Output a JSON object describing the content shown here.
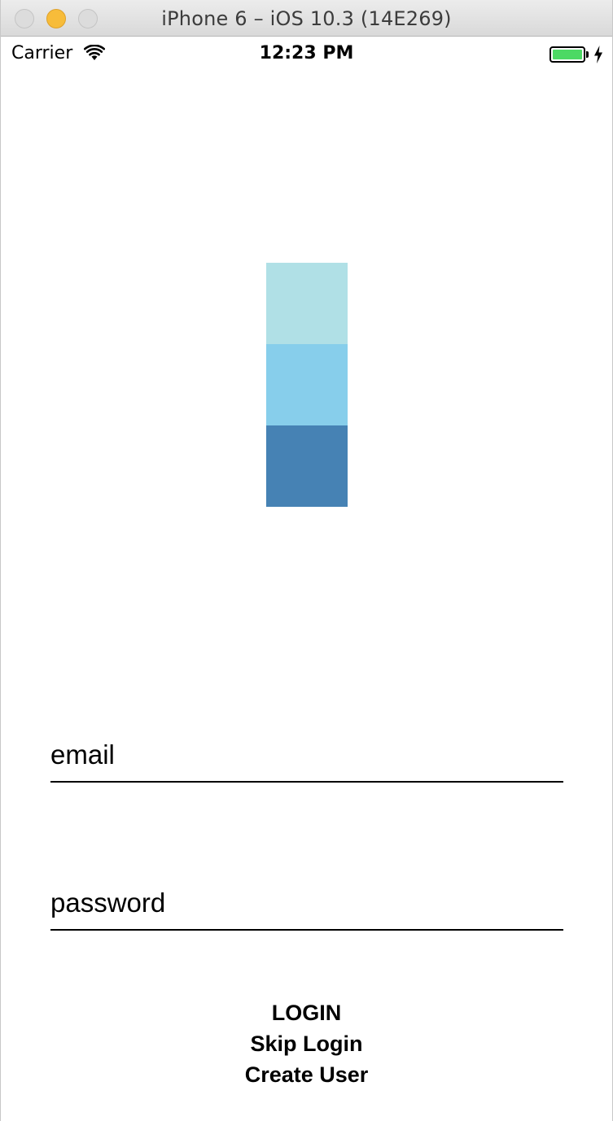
{
  "window": {
    "title": "iPhone 6 – iOS 10.3 (14E269)"
  },
  "status_bar": {
    "carrier": "Carrier",
    "time": "12:23 PM",
    "battery_level": 1.0,
    "battery_color": "#4cd964",
    "wifi_icon": "wifi-icon",
    "charging_icon": "charging-bolt-icon"
  },
  "logo": {
    "colors": [
      "#b0e0e6",
      "#87ceeb",
      "#4682b4"
    ]
  },
  "form": {
    "email_placeholder": "email",
    "email_value": "",
    "password_placeholder": "password",
    "password_value": ""
  },
  "buttons": {
    "login": "LOGIN",
    "skip": "Skip Login",
    "create": "Create User"
  }
}
